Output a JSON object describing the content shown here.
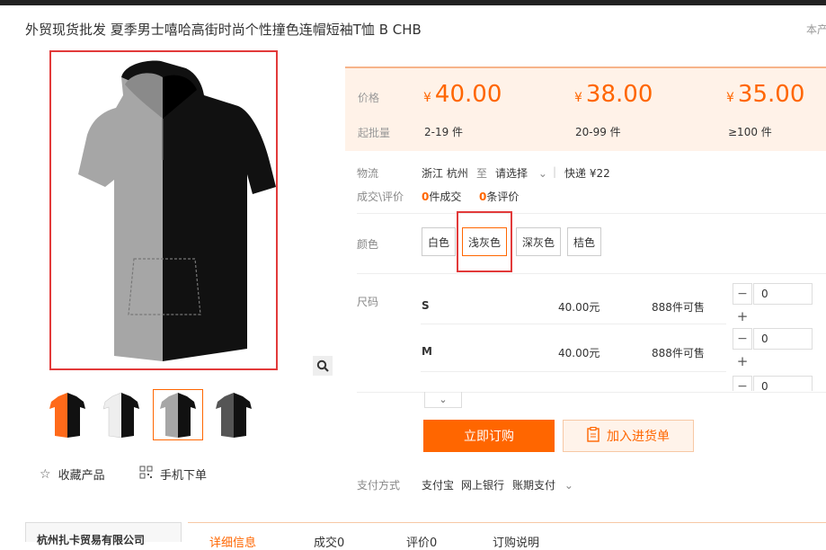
{
  "header": {
    "title": "外贸现货批发 夏季男士嘻哈高街时尚个性撞色连帽短袖T恤 B CHB",
    "title_right": "本产"
  },
  "gallery": {
    "thumbnails": [
      {
        "color": "#ff6a1a",
        "name": "thumb-orange"
      },
      {
        "color": "#f0f0f0",
        "name": "thumb-white"
      },
      {
        "color": "#a8a8a8",
        "name": "thumb-lightgray"
      },
      {
        "color": "#555555",
        "name": "thumb-darkgray"
      }
    ],
    "selected_index": 2
  },
  "actions": {
    "favorite": "收藏产品",
    "mobile": "手机下单"
  },
  "price": {
    "price_label": "价格",
    "moq_label": "起批量",
    "currency": "¥",
    "tiers": [
      {
        "price": "40.00",
        "qty": "2-19 件"
      },
      {
        "price": "38.00",
        "qty": "20-99 件"
      },
      {
        "price": "35.00",
        "qty": "≥100 件"
      }
    ]
  },
  "logistics": {
    "label": "物流",
    "from": "浙江 杭州",
    "to_word": "至",
    "select": "请选择",
    "express": "快递 ¥22"
  },
  "stats": {
    "label": "成交\\评价",
    "deals_count": "0",
    "deals_text": "件成交",
    "reviews_count": "0",
    "reviews_text": "条评价"
  },
  "colors": {
    "label": "颜色",
    "options": [
      "白色",
      "浅灰色",
      "深灰色",
      "桔色"
    ],
    "selected": "浅灰色"
  },
  "sizes": {
    "label": "尺码",
    "rows": [
      {
        "name": "S",
        "price": "40.00元",
        "stock": "888件可售",
        "qty": "0"
      },
      {
        "name": "M",
        "price": "40.00元",
        "stock": "888件可售",
        "qty": "0"
      },
      {
        "name": "",
        "price": "",
        "stock": "",
        "qty": "0"
      }
    ]
  },
  "buttons": {
    "buy": "立即订购",
    "cart": "加入进货单"
  },
  "payment": {
    "label": "支付方式",
    "methods": [
      "支付宝",
      "网上银行",
      "账期支付"
    ]
  },
  "footer": {
    "company": "杭州扎卡贸易有限公司",
    "tabs": [
      "详细信息",
      "成交0",
      "评价0",
      "订购说明"
    ]
  }
}
